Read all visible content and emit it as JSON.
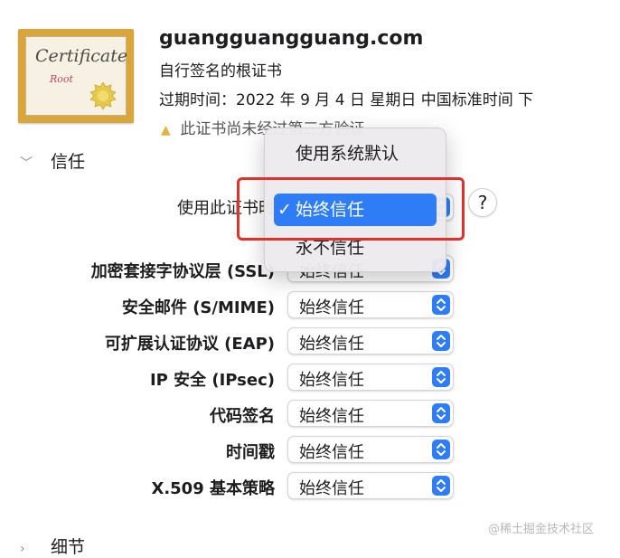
{
  "certificate": {
    "thumbnail_title": "Certificate",
    "thumbnail_sub": "Root",
    "domain": "guangguangguang.com",
    "type": "自行签名的根证书",
    "expiry": "过期时间：2022 年 9 月 4 日 星期日 中国标准时间 下",
    "warning": "此证书尚未经过第三方验证",
    "warning_icon": "warning-triangle-icon"
  },
  "trust": {
    "section_label": "信任",
    "use_label": "使用此证书时",
    "help_label": "?",
    "menu": {
      "items": [
        {
          "label": "使用系统默认",
          "selected": false
        },
        {
          "label": "始终信任",
          "selected": true
        },
        {
          "label": "永不信任",
          "selected": false
        }
      ],
      "check": "✓"
    },
    "rows": [
      {
        "label": "加密套接字协议层 (SSL)",
        "value": "始终信任"
      },
      {
        "label": "安全邮件 (S/MIME)",
        "value": "始终信任"
      },
      {
        "label": "可扩展认证协议 (EAP)",
        "value": "始终信任"
      },
      {
        "label": "IP 安全 (IPsec)",
        "value": "始终信任"
      },
      {
        "label": "代码签名",
        "value": "始终信任"
      },
      {
        "label": "时间戳",
        "value": "始终信任"
      },
      {
        "label": "X.509 基本策略",
        "value": "始终信任"
      }
    ]
  },
  "details": {
    "section_label": "细节"
  },
  "watermark": "@稀土掘金技术社区",
  "colors": {
    "accent": "#2f7df6",
    "highlight": "#e0312b"
  }
}
